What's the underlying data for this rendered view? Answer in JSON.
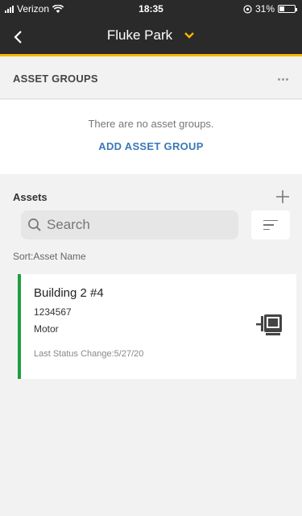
{
  "status_bar": {
    "carrier": "Verizon",
    "time": "18:35",
    "battery_text": "31%",
    "battery_level": 0.31
  },
  "nav": {
    "title": "Fluke Park",
    "accent_color": "#f5b800"
  },
  "asset_groups": {
    "title": "ASSET GROUPS",
    "empty_message": "There are no asset groups.",
    "add_label": "ADD ASSET GROUP"
  },
  "assets": {
    "title": "Assets",
    "search_placeholder": "Search",
    "sort_label": "Sort:Asset Name",
    "items": [
      {
        "name": "Building 2 #4",
        "id": "1234567",
        "type": "Motor",
        "status": "Last Status Change:5/27/20",
        "icon": "motor-icon",
        "status_color": "#1f9e3f"
      }
    ]
  }
}
